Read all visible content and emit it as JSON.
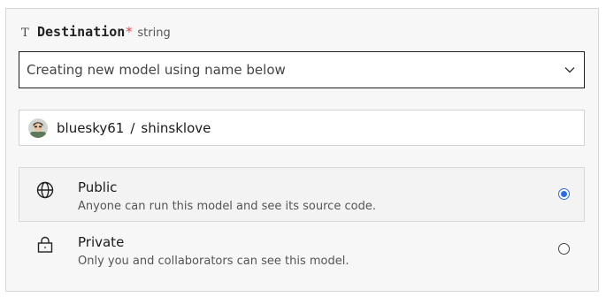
{
  "field": {
    "type_icon": "T",
    "name": "Destination",
    "required_mark": "*",
    "type": "string"
  },
  "destination_select": {
    "value": "Creating new model using name below",
    "icon": "chevron-down-icon"
  },
  "model_name": {
    "owner": "bluesky61",
    "separator": "/",
    "name": "shinsklove",
    "avatar_icon": "user-avatar"
  },
  "visibility": {
    "options": [
      {
        "title": "Public",
        "description": "Anyone can run this model and see its source code.",
        "icon": "globe-icon",
        "selected": true
      },
      {
        "title": "Private",
        "description": "Only you and collaborators can see this model.",
        "icon": "lock-icon",
        "selected": false
      }
    ]
  },
  "colors": {
    "accent": "#2b6be6",
    "required": "#e5484d",
    "panel_bg": "#f7f7f7"
  }
}
